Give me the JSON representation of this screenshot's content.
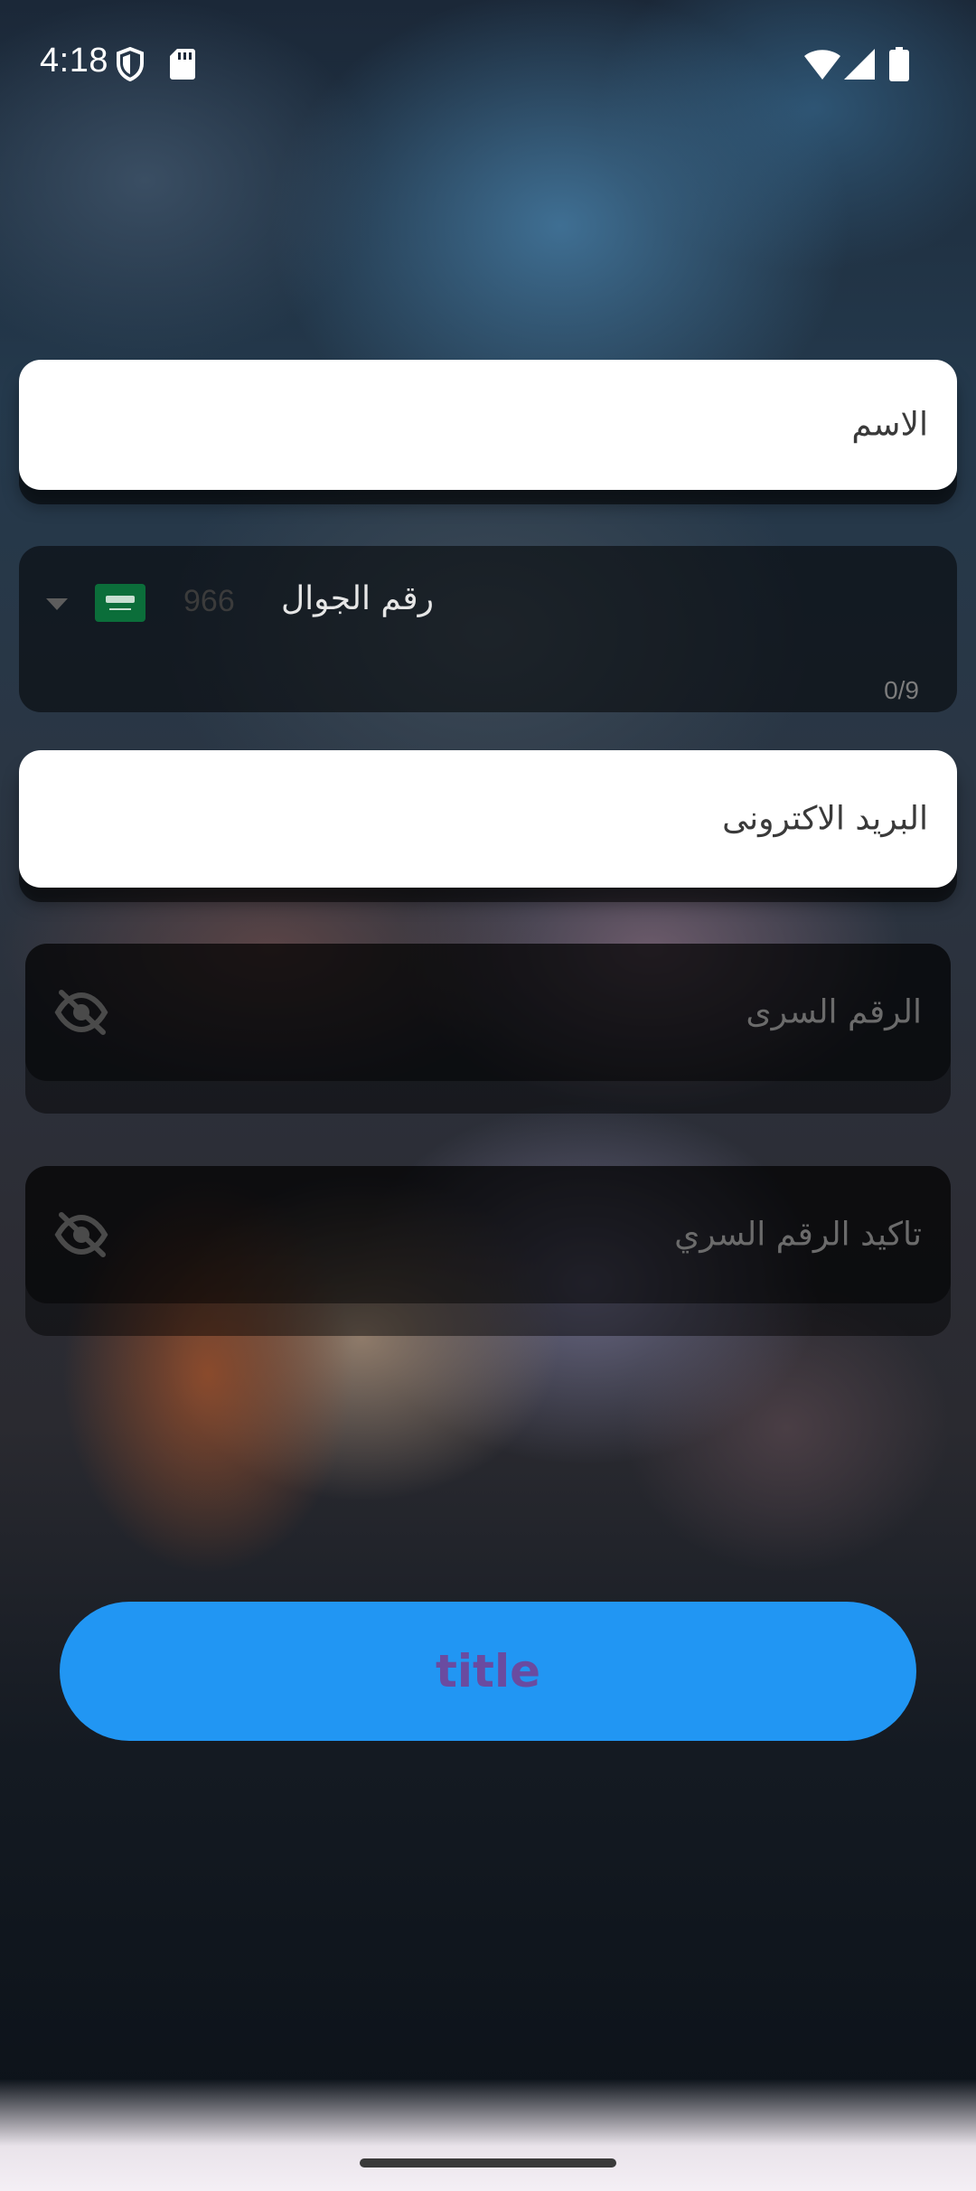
{
  "status_bar": {
    "time": "4:18",
    "left_icons": [
      "shield-icon",
      "sd-card-icon"
    ],
    "right_icons": [
      "wifi-icon",
      "cellular-signal-icon",
      "battery-icon"
    ]
  },
  "form": {
    "name_field": {
      "placeholder": "الاسم"
    },
    "phone_field": {
      "label": "رقم الجوال",
      "country_code": "966",
      "country_flag": "saudi-arabia-flag-icon",
      "counter": "0/9"
    },
    "email_field": {
      "placeholder": "البريد الاكترونى"
    },
    "password_field": {
      "placeholder": "الرقم السرى"
    },
    "confirm_password_field": {
      "placeholder": "تاكيد الرقم السري"
    }
  },
  "submit_button": {
    "label": "title"
  },
  "colors": {
    "button": "#2196f3",
    "button_text": "#6a4ba0",
    "field_light": "#ffffff",
    "field_dark": "#0a0a0a"
  }
}
